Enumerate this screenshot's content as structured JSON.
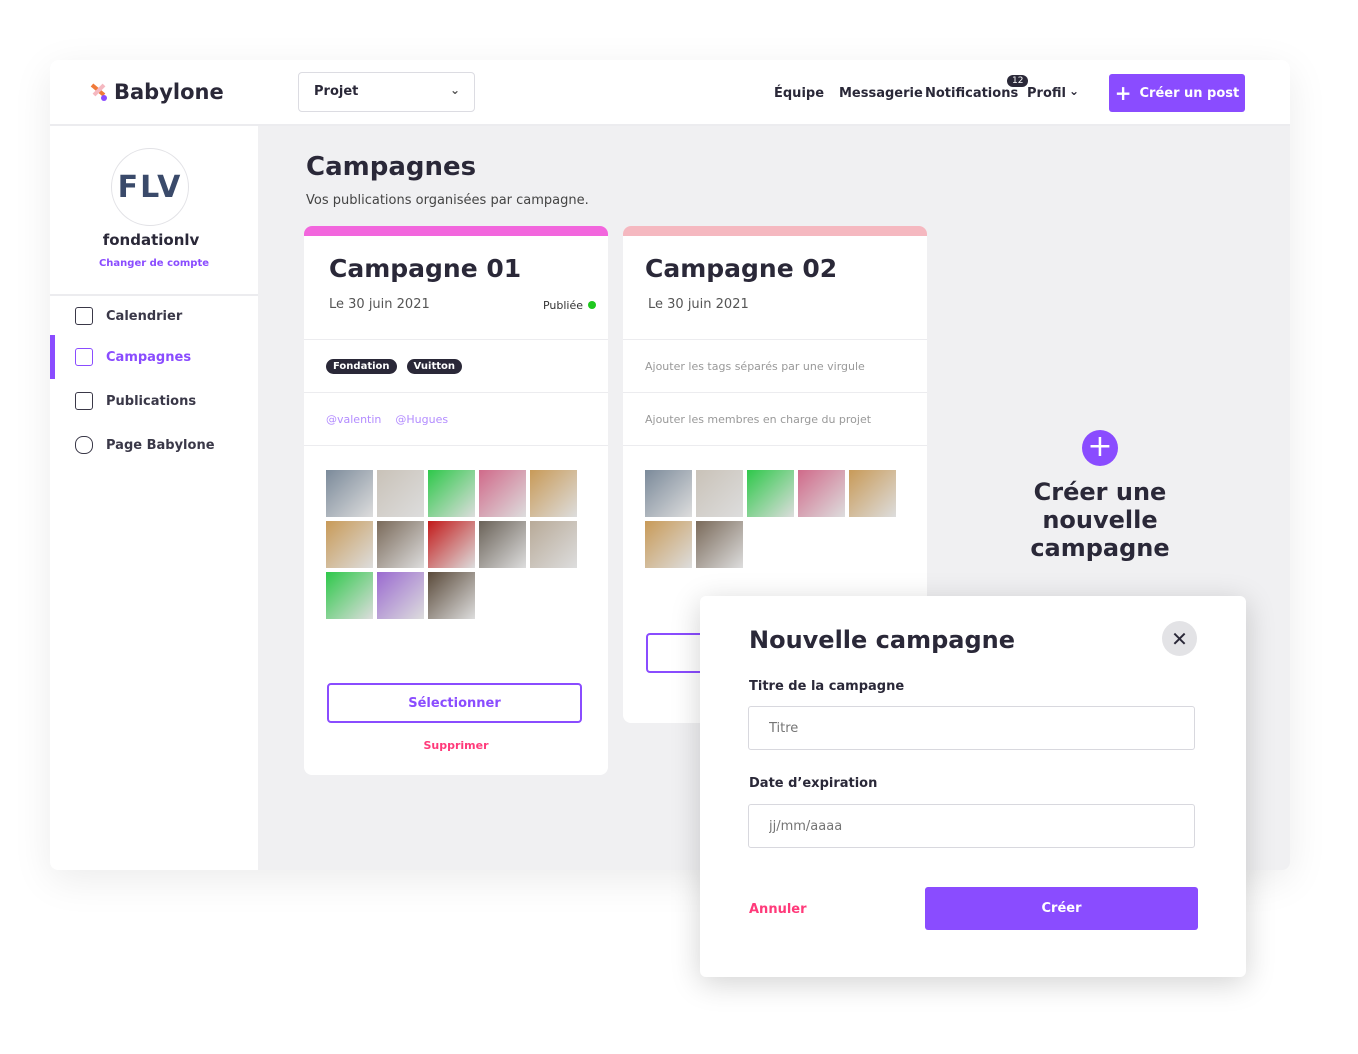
{
  "header": {
    "brand": "Babylone",
    "project_select": "Projet",
    "nav": [
      "Équipe",
      "Messagerie",
      "Notifications",
      "Profil"
    ],
    "notifications_count": "12",
    "create_post": "Créer un post"
  },
  "sidebar": {
    "avatar_text": "FLV",
    "username": "fondationlv",
    "switch_account": "Changer de compte",
    "items": [
      {
        "label": "Calendrier",
        "icon": "calendar-icon"
      },
      {
        "label": "Campagnes",
        "icon": "grid-icon",
        "active": true
      },
      {
        "label": "Publications",
        "icon": "list-icon"
      },
      {
        "label": "Page Babylone",
        "icon": "page-icon"
      }
    ]
  },
  "main": {
    "title": "Campagnes",
    "subtitle": "Vos publications organisées par campagne.",
    "campaigns": [
      {
        "title": "Campagne 01",
        "date": "Le 30 juin 2021",
        "status": "Publiée",
        "status_color": "#1ec81e",
        "accent": "#f266dd",
        "tags": [
          "Fondation",
          "Vuitton"
        ],
        "members": [
          "@valentin",
          "@Hugues"
        ],
        "thumb_colors": [
          "#7b8a9a",
          "#c9c2b8",
          "#2ec84a",
          "#d06a8a",
          "#c89a58",
          "#c89a58",
          "#7a6a5a",
          "#c21a1a",
          "#6a6258",
          "#b8aa98",
          "#2ec84a",
          "#9a6ad0",
          "#5a4a3a"
        ],
        "select": "Sélectionner",
        "delete": "Supprimer"
      },
      {
        "title": "Campagne 02",
        "date": "Le 30 juin 2021",
        "accent": "#f5b8c0",
        "tags_placeholder": "Ajouter les tags séparés par une virgule",
        "members_placeholder": "Ajouter les membres en charge du projet",
        "thumb_colors": [
          "#7b8a9a",
          "#c9c2b8",
          "#2ec84a",
          "#d06a8a",
          "#c89a58",
          "#c89a58",
          "#7a6a5a"
        ]
      }
    ],
    "new_campaign": "Créer une nouvelle campagne"
  },
  "modal": {
    "title": "Nouvelle campagne",
    "title_label": "Titre de la campagne",
    "title_placeholder": "Titre",
    "date_label": "Date d’expiration",
    "date_placeholder": "jj/mm/aaaa",
    "cancel": "Annuler",
    "create": "Créer"
  },
  "colors": {
    "accent": "#8a4cff",
    "danger": "#ff3a7a"
  }
}
